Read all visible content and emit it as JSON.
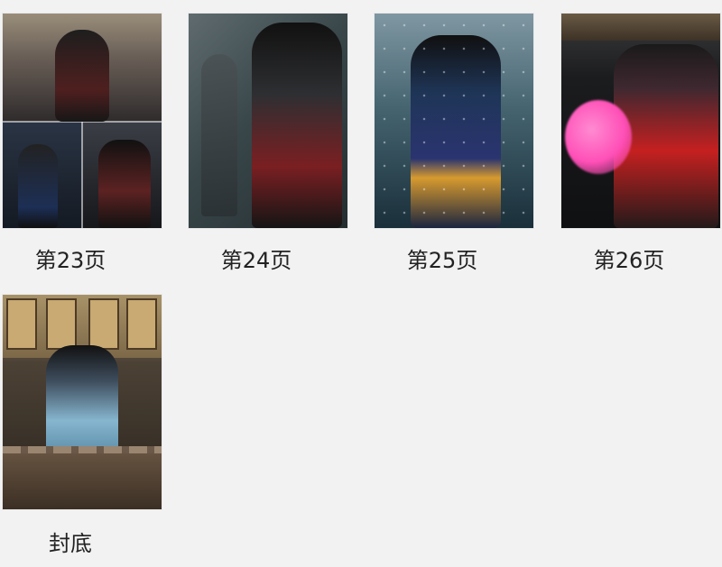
{
  "pages": [
    {
      "label": "第23页",
      "image_icon": "photo-collage-icon"
    },
    {
      "label": "第24页",
      "image_icon": "photo-icon"
    },
    {
      "label": "第25页",
      "image_icon": "photo-icon"
    },
    {
      "label": "第26页",
      "image_icon": "photo-icon"
    },
    {
      "label": "封底",
      "image_icon": "photo-icon"
    }
  ],
  "colors": {
    "background": "#f2f2f3",
    "caption_text": "#222222"
  }
}
